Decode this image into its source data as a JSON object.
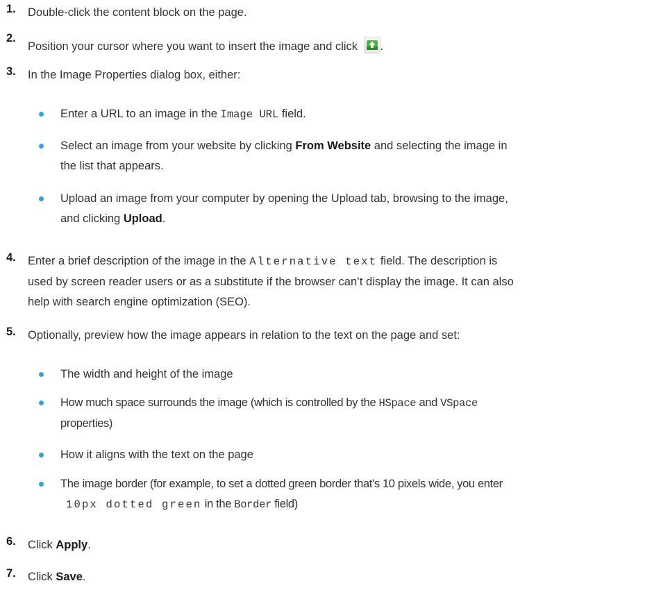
{
  "steps": [
    {
      "number": "1.",
      "text": "Double-click the content block on the page."
    },
    {
      "number": "2.",
      "text": "Position your cursor where you want to insert the image and click",
      "icon": "insert-image-icon",
      "after_icon": "."
    },
    {
      "number": "3.",
      "text": "In the Image Properties dialog box, either:",
      "bullets": [
        {
          "pre": "Enter a URL to an image in the",
          "code": "Image URL",
          "post": "field."
        },
        {
          "pre": "Select an image from your website by clicking",
          "bold": "From Website",
          "post_line1": "and selecting the image in",
          "post_line2": "the list that appears."
        },
        {
          "line1": "Upload an image from your computer by opening the Upload tab, browsing to the image,",
          "pre2": "and clicking",
          "bold": "Upload",
          "post": "."
        }
      ]
    },
    {
      "number": "4.",
      "pre": "Enter a brief description of the image in the",
      "code": "Alternative text",
      "post": "field. The description is",
      "line2": "used by screen reader users or as a substitute if the browser can’t display the image. It can also",
      "line3": "help with search engine optimization (SEO)."
    },
    {
      "number": "5.",
      "text": "Optionally, preview how the image appears in relation to the text on the page and set:",
      "bullets": [
        {
          "text": "The width and height of the image"
        },
        {
          "pre": "How much space surrounds the image (which is controlled by the",
          "code1": "HSpace",
          "mid": "and",
          "code2": "VSpace",
          "line2": "properties)"
        },
        {
          "text": "How it aligns with the text on the page"
        },
        {
          "line1": "The image border (for example, to set a dotted green border that's 10 pixels wide, you enter",
          "code1": "10px dotted green",
          "mid": "in the",
          "code2": "Border",
          "post": "field)"
        }
      ]
    },
    {
      "number": "6.",
      "pre": "Click",
      "bold": "Apply",
      "post": "."
    },
    {
      "number": "7.",
      "pre": "Click",
      "bold": "Save",
      "post": "."
    }
  ],
  "colors": {
    "bullet": "#2ea3e3",
    "icon_green": "#3fa535"
  }
}
